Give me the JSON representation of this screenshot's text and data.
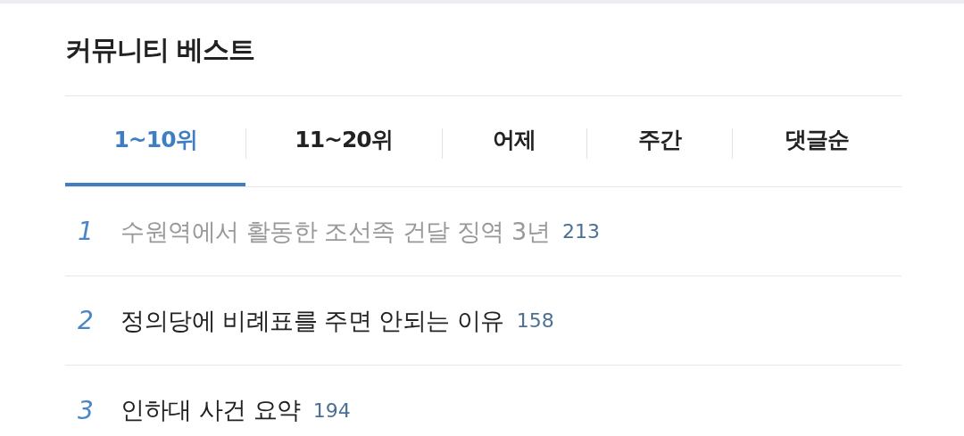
{
  "section": {
    "title": "커뮤니티 베스트"
  },
  "tabs": [
    {
      "label": "1~10위",
      "selected": true
    },
    {
      "label": "11~20위",
      "selected": false
    },
    {
      "label": "어제",
      "selected": false
    },
    {
      "label": "주간",
      "selected": false
    },
    {
      "label": "댓글순",
      "selected": false
    }
  ],
  "posts": [
    {
      "rank": "1",
      "title": "수원역에서 활동한 조선족 건달 징역 3년",
      "comments": "213",
      "visited": true
    },
    {
      "rank": "2",
      "title": "정의당에 비례표를 주면 안되는 이유",
      "comments": "158",
      "visited": false
    },
    {
      "rank": "3",
      "title": "인하대 사건 요약",
      "comments": "194",
      "visited": false
    }
  ]
}
